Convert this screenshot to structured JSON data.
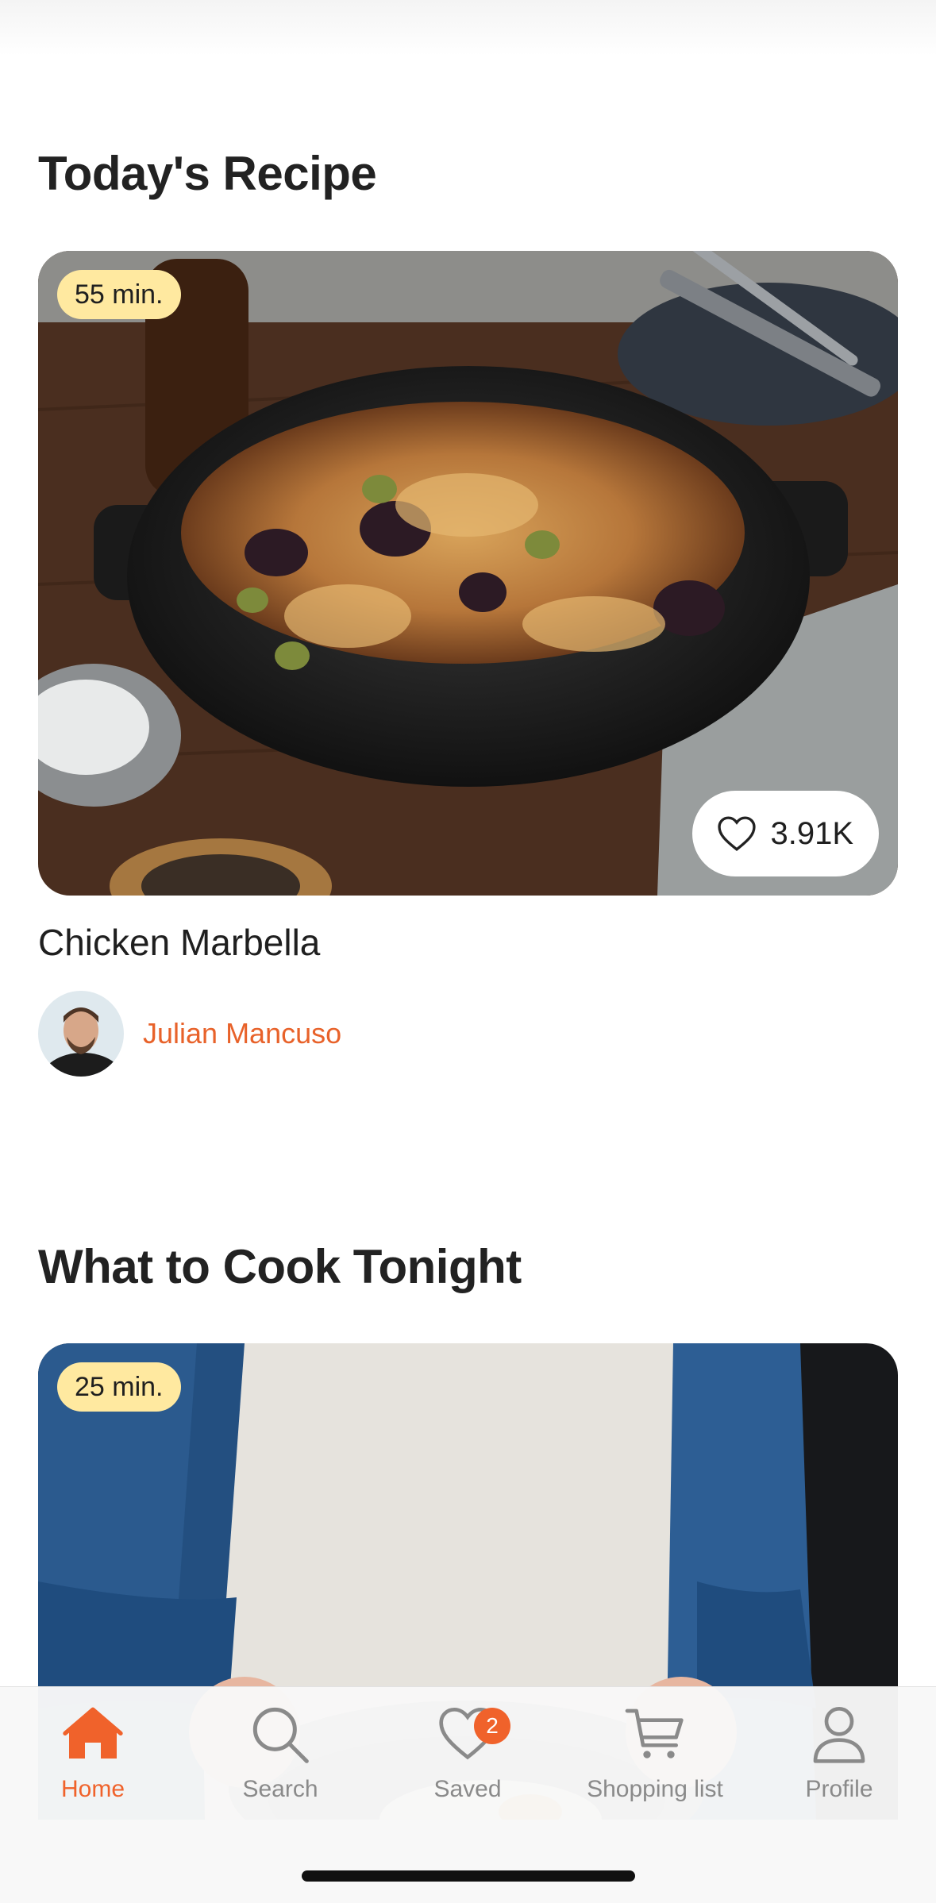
{
  "sections": {
    "today_title": "Today's Recipe",
    "tonight_title": "What to Cook Tonight"
  },
  "today_recipe": {
    "time": "55 min.",
    "likes": "3.91K",
    "name": "Chicken Marbella",
    "author": "Julian Mancuso"
  },
  "tonight_recipe": {
    "time": "25 min."
  },
  "tabbar": {
    "active": "home",
    "items": [
      {
        "id": "home",
        "label": "Home",
        "icon": "home-icon"
      },
      {
        "id": "search",
        "label": "Search",
        "icon": "search-icon"
      },
      {
        "id": "saved",
        "label": "Saved",
        "icon": "heart-icon",
        "badge": "2"
      },
      {
        "id": "shopping",
        "label": "Shopping list",
        "icon": "cart-icon"
      },
      {
        "id": "profile",
        "label": "Profile",
        "icon": "person-icon"
      }
    ]
  },
  "colors": {
    "accent": "#f0622b",
    "badge_bg": "#ffe9a0",
    "author": "#e8622a"
  }
}
